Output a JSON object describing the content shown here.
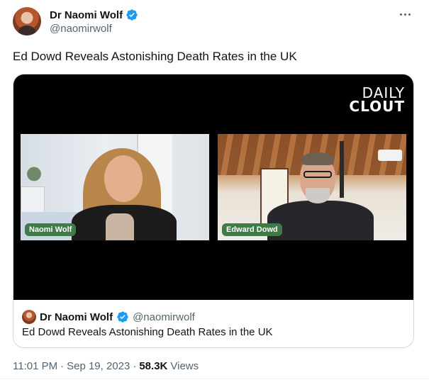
{
  "author": {
    "display_name": "Dr Naomi Wolf",
    "handle": "@naomirwolf",
    "verified": true,
    "verified_color": "#1d9bf0"
  },
  "tweet": {
    "text": "Ed Dowd Reveals Astonishing Death Rates in the UK"
  },
  "video": {
    "brand_line1": "DAILY",
    "brand_line2": "CLOUT",
    "left_speaker": "Naomi Wolf",
    "right_speaker": "Edward Dowd",
    "nametag_color": "#3f7a47"
  },
  "quoted": {
    "display_name": "Dr Naomi Wolf",
    "handle": "@naomirwolf",
    "text": "Ed Dowd Reveals Astonishing Death Rates in the UK"
  },
  "meta": {
    "time": "11:01 PM",
    "sep1": "·",
    "date": "Sep 19, 2023",
    "sep2": "·",
    "views_count": "58.3K",
    "views_label": "Views"
  },
  "icons": {
    "more": "more-dots-icon",
    "verified": "verified-badge-icon"
  }
}
